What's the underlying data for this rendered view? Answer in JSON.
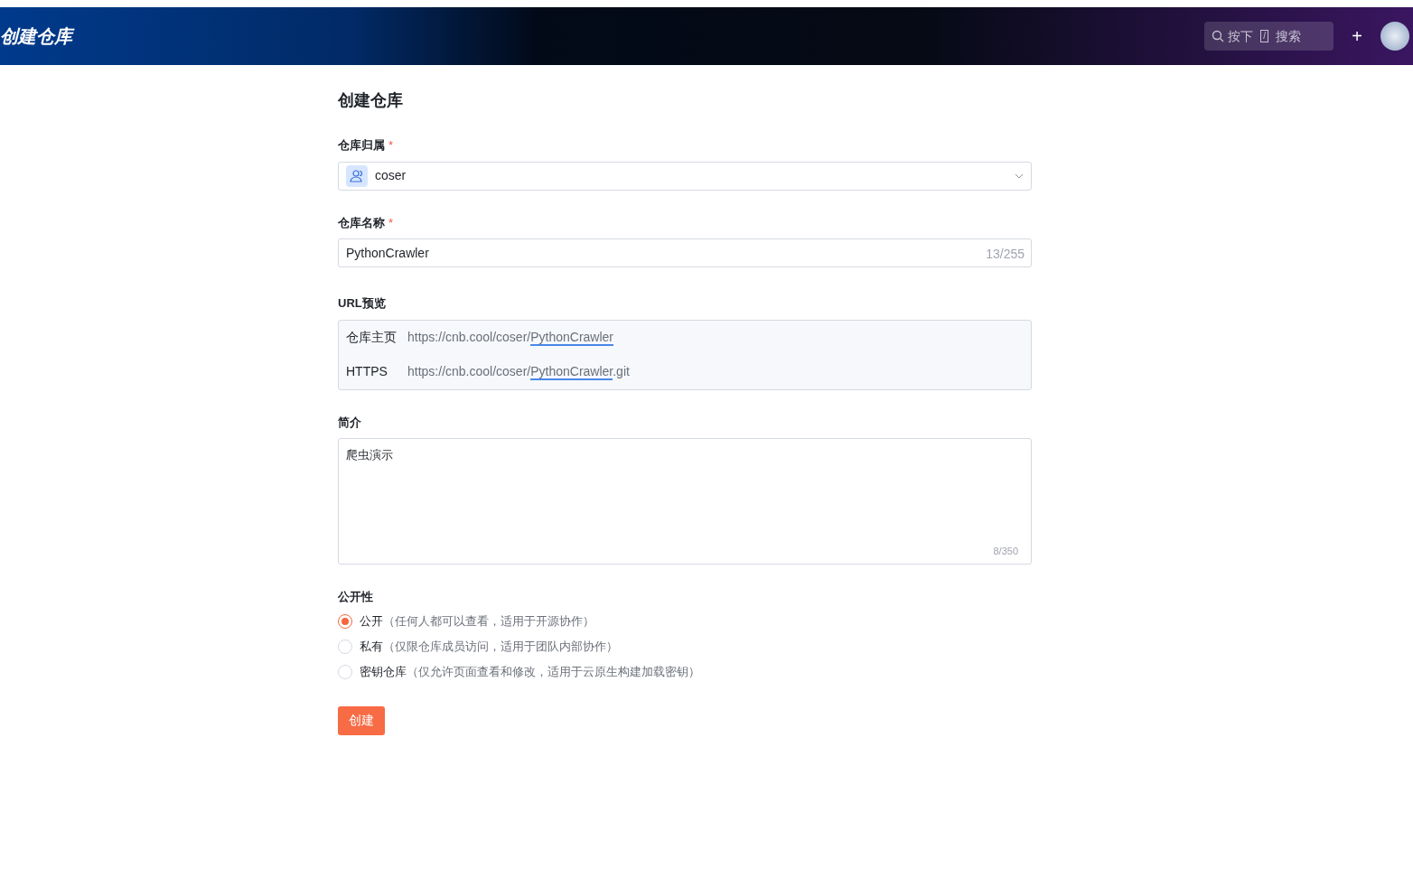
{
  "header": {
    "title": "创建仓库",
    "search": {
      "prefix": "按下",
      "key": "/",
      "suffix": "搜索"
    },
    "add": "+"
  },
  "page_title": "创建仓库",
  "owner": {
    "label": "仓库归属",
    "required_mark": "*",
    "value": "coser"
  },
  "name": {
    "label": "仓库名称",
    "required_mark": "*",
    "value": "PythonCrawler",
    "counter": "13/255"
  },
  "url_preview": {
    "label": "URL预览",
    "rows": [
      {
        "label": "仓库主页",
        "base": "https://cnb.cool/coser/",
        "highlight": "PythonCrawler",
        "suffix": ""
      },
      {
        "label": "HTTPS",
        "base": "https://cnb.cool/coser/",
        "highlight": "PythonCrawler",
        "suffix": ".git"
      }
    ]
  },
  "description": {
    "label": "简介",
    "value": "爬虫演示",
    "counter": "8/350"
  },
  "visibility": {
    "label": "公开性",
    "options": [
      {
        "label": "公开",
        "hint": "（任何人都可以查看，适用于开源协作）",
        "selected": true
      },
      {
        "label": "私有",
        "hint": "（仅限仓库成员访问，适用于团队内部协作）",
        "selected": false
      },
      {
        "label": "密钥仓库",
        "hint": "（仅允许页面查看和修改，适用于云原生构建加载密钥）",
        "selected": false
      }
    ]
  },
  "submit": "创建"
}
